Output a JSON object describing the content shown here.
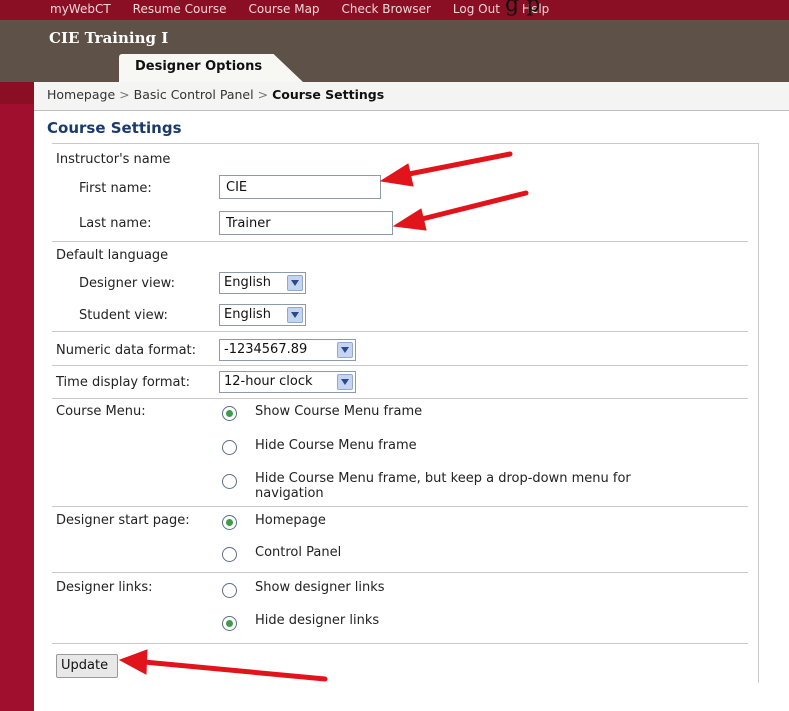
{
  "top_nav": {
    "links": [
      "myWebCT",
      "Resume Course",
      "Course Map",
      "Check Browser",
      "Log Out",
      "Help"
    ],
    "overlay_text": "g              p"
  },
  "app_title": "CIE Training I",
  "tab_label": "Designer Options",
  "breadcrumb": {
    "home": "Homepage",
    "separator": ">",
    "panel": "Basic Control Panel",
    "current": "Course Settings"
  },
  "page_title": "Course Settings",
  "form": {
    "instructor": {
      "heading": "Instructor's name",
      "first_label": "First name:",
      "first_value": "CIE",
      "last_label": "Last name:",
      "last_value": "Trainer"
    },
    "language": {
      "heading": "Default language",
      "designer_label": "Designer view:",
      "designer_value": "English",
      "student_label": "Student view:",
      "student_value": "English"
    },
    "numeric": {
      "label": "Numeric data format:",
      "value": "-1234567.89"
    },
    "time": {
      "label": "Time display format:",
      "value": "12-hour clock"
    },
    "course_menu": {
      "label": "Course Menu:",
      "options": [
        {
          "text": "Show Course Menu frame",
          "selected": true
        },
        {
          "text": "Hide Course Menu frame",
          "selected": false
        },
        {
          "text": "Hide Course Menu frame, but keep a drop-down menu for",
          "text2": "navigation",
          "selected": false
        }
      ]
    },
    "start_page": {
      "label": "Designer start page:",
      "options": [
        {
          "text": "Homepage",
          "selected": true
        },
        {
          "text": "Control Panel",
          "selected": false
        }
      ]
    },
    "designer_links": {
      "label": "Designer links:",
      "options": [
        {
          "text": "Show designer links",
          "selected": false
        },
        {
          "text": "Hide designer links",
          "selected": true
        }
      ]
    },
    "submit_label": "Update"
  },
  "colors": {
    "accent_red": "#a0102e",
    "title_bar": "#5e5148",
    "section_title": "#1b3a6b",
    "annotation_arrow": "#e0141a"
  }
}
